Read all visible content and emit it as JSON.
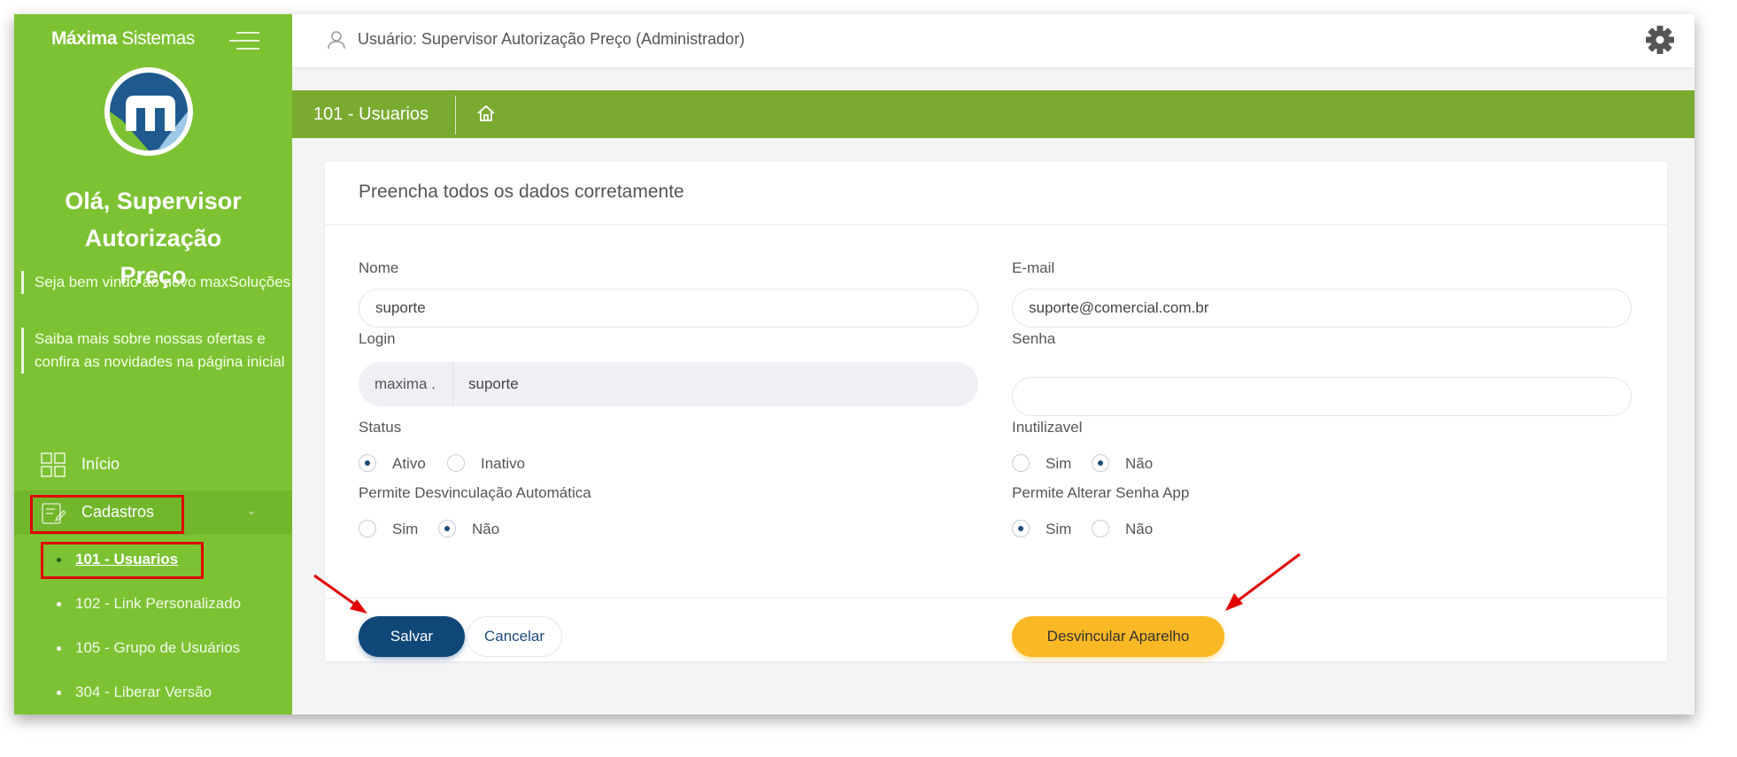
{
  "brand": {
    "bold": "Máxima",
    "rest": "Sistemas"
  },
  "sidebar": {
    "greeting": "Olá, Supervisor Autorização Preço",
    "notices": [
      "Seja bem vindo ao novo maxSoluções",
      "Saiba mais sobre nossas ofertas e confira as novidades na página inicial"
    ],
    "nav": [
      {
        "label": "Início",
        "icon": "grid-icon"
      },
      {
        "label": "Cadastros",
        "icon": "edit-icon"
      }
    ],
    "sub_items": [
      "101 - Usuarios",
      "102 - Link Personalizado",
      "105 - Grupo de Usuários",
      "304 - Liberar Versão"
    ]
  },
  "topbar": {
    "user_text": "Usuário: Supervisor Autorização Preço (Administrador)"
  },
  "breadcrumb": {
    "title": "101 - Usuarios"
  },
  "form": {
    "title": "Preencha todos os dados corretamente",
    "nome": {
      "label": "Nome",
      "value": "suporte"
    },
    "email": {
      "label": "E-mail",
      "value": "suporte@comercial.com.br"
    },
    "login": {
      "label": "Login",
      "prefix": "maxima .",
      "value": "suporte"
    },
    "senha": {
      "label": "Senha",
      "value": ""
    },
    "status": {
      "label": "Status",
      "options": [
        "Ativo",
        "Inativo"
      ],
      "selected": "Ativo"
    },
    "inutilizavel": {
      "label": "Inutilizavel",
      "options": [
        "Sim",
        "Não"
      ],
      "selected": "Não"
    },
    "desvinculacao": {
      "label": "Permite Desvinculação Automática",
      "options": [
        "Sim",
        "Não"
      ],
      "selected": "Não"
    },
    "alterar_senha": {
      "label": "Permite Alterar Senha App",
      "options": [
        "Sim",
        "Não"
      ],
      "selected": "Sim"
    }
  },
  "buttons": {
    "save": "Salvar",
    "cancel": "Cancelar",
    "unlink": "Desvincular Aparelho"
  },
  "colors": {
    "sidebar": "#7dc233",
    "crumbbar": "#7aab31",
    "primary": "#0e4778",
    "warning": "#fbb825",
    "highlight": "#e00000"
  }
}
